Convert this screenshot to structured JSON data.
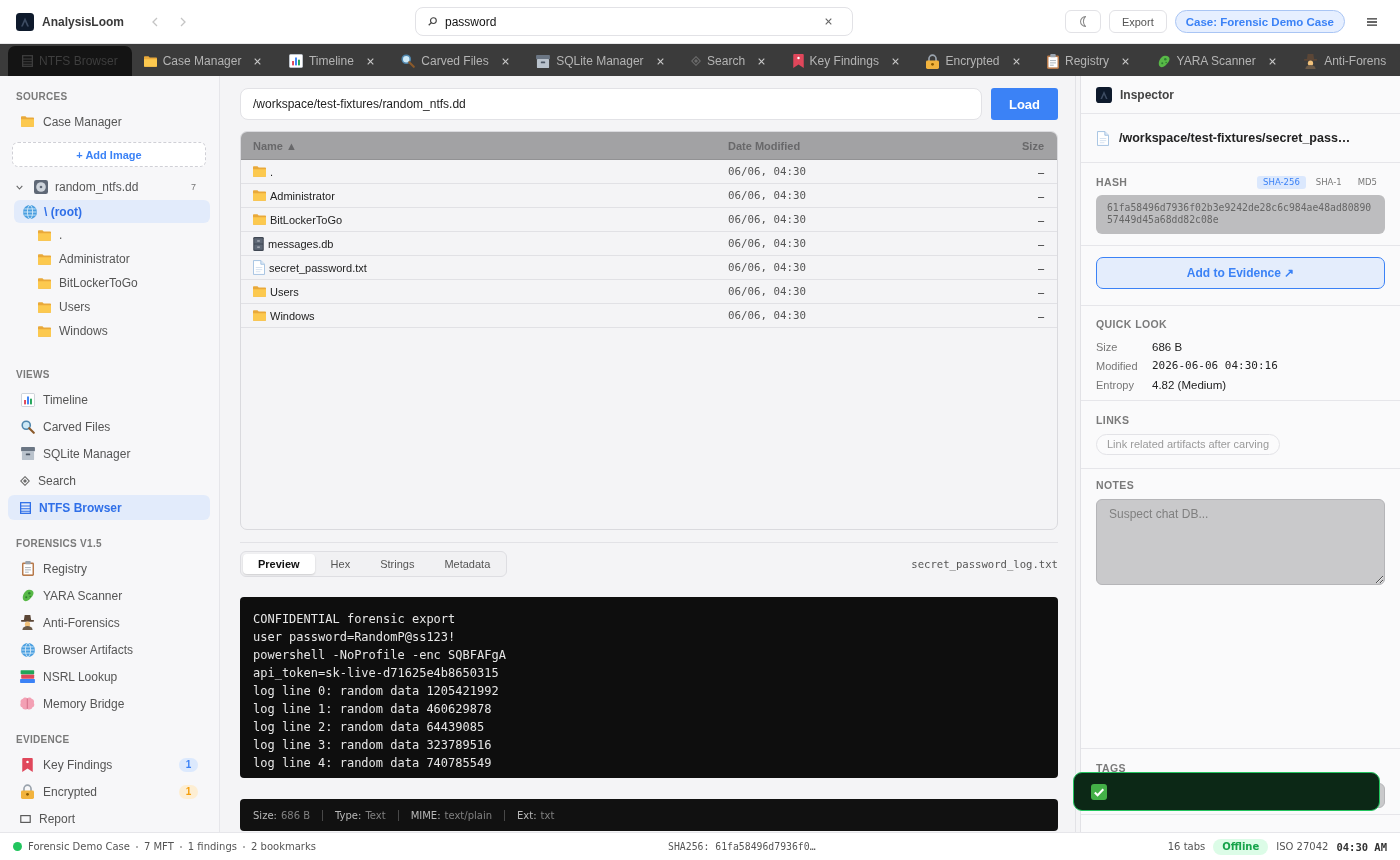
{
  "header": {
    "app_name": "AnalysisLoom",
    "nav": [
      {
        "kind": "back",
        "disabled": true
      },
      {
        "kind": "forward",
        "disabled": true
      }
    ],
    "search": {
      "value": "password"
    },
    "export_button": "Export",
    "case_badge": "Case: Forensic Demo Case"
  },
  "tabs": [
    {
      "label": "NTFS Browser",
      "kind": "list",
      "selected": true,
      "closable": false
    },
    {
      "label": "Case Manager",
      "kind": "folder",
      "selected": false,
      "closable": true
    },
    {
      "label": "Timeline",
      "kind": "chart",
      "selected": false,
      "closable": true
    },
    {
      "label": "Carved Files",
      "kind": "magnifier",
      "selected": false,
      "closable": true
    },
    {
      "label": "SQLite Manager",
      "kind": "cardbox",
      "selected": false,
      "closable": true
    },
    {
      "label": "Search",
      "kind": "diamond",
      "selected": false,
      "closable": true
    },
    {
      "label": "Key Findings",
      "kind": "bookmark",
      "selected": false,
      "closable": true
    },
    {
      "label": "Encrypted",
      "kind": "lock",
      "selected": false,
      "closable": true
    },
    {
      "label": "Registry",
      "kind": "clipboard",
      "selected": false,
      "closable": true
    },
    {
      "label": "YARA Scanner",
      "kind": "microbe",
      "selected": false,
      "closable": true
    },
    {
      "label": "Anti-Forens",
      "kind": "detective",
      "selected": false,
      "closable": false
    }
  ],
  "sidebar": {
    "sources": {
      "title": "SOURCES",
      "items": [
        {
          "label": "Case Manager",
          "kind": "folder",
          "selected": false
        }
      ],
      "add_button": "+ Add Image",
      "tree": [
        {
          "label": "random_ntfs.dd",
          "kind": "disk",
          "count": "7",
          "expanded": true,
          "selected": false,
          "children": [
            {
              "label": "\\ (root)",
              "kind": "globe",
              "selected": true,
              "children": [
                {
                  "label": ".",
                  "kind": "folder",
                  "selected": false
                },
                {
                  "label": "Administrator",
                  "kind": "folder",
                  "selected": false
                },
                {
                  "label": "BitLockerToGo",
                  "kind": "folder",
                  "selected": false
                },
                {
                  "label": "Users",
                  "kind": "folder",
                  "selected": false
                },
                {
                  "label": "Windows",
                  "kind": "folder",
                  "selected": false
                }
              ]
            }
          ]
        }
      ]
    },
    "sections": [
      {
        "title": "VIEWS",
        "items": [
          {
            "label": "Timeline",
            "kind": "chart",
            "selected": false
          },
          {
            "label": "Carved Files",
            "kind": "magnifier",
            "selected": false
          },
          {
            "label": "SQLite Manager",
            "kind": "cardbox",
            "selected": false
          },
          {
            "label": "Search",
            "kind": "diamond",
            "selected": false
          },
          {
            "label": "NTFS Browser",
            "kind": "list",
            "selected": true
          }
        ]
      },
      {
        "title": "FORENSICS V1.5",
        "items": [
          {
            "label": "Registry",
            "kind": "clipboard",
            "selected": false
          },
          {
            "label": "YARA Scanner",
            "kind": "microbe",
            "selected": false
          },
          {
            "label": "Anti-Forensics",
            "kind": "detective",
            "selected": false
          },
          {
            "label": "Browser Artifacts",
            "kind": "globe",
            "selected": false
          },
          {
            "label": "NSRL Lookup",
            "kind": "books",
            "selected": false
          },
          {
            "label": "Memory Bridge",
            "kind": "brain",
            "selected": false
          }
        ]
      },
      {
        "title": "EVIDENCE",
        "items": [
          {
            "label": "Key Findings",
            "kind": "bookmark",
            "selected": false,
            "badge": {
              "text": "1",
              "color": "#3b82f6"
            }
          },
          {
            "label": "Encrypted",
            "kind": "lock",
            "selected": false,
            "badge": {
              "text": "1",
              "color": "#f59e0b"
            }
          },
          {
            "label": "Report",
            "kind": "rect",
            "selected": false
          }
        ]
      }
    ]
  },
  "browser": {
    "path": {
      "value": "/workspace/test-fixtures/random_ntfs.dd",
      "button": "Load"
    },
    "table": {
      "columns": [
        "Name ▲",
        "Date Modified",
        "Size"
      ],
      "rows": [
        {
          "kind": "folder",
          "name": ".",
          "modified": "06/06, 04:30",
          "size": "–"
        },
        {
          "kind": "folder",
          "name": "Administrator",
          "modified": "06/06, 04:30",
          "size": "–"
        },
        {
          "kind": "folder",
          "name": "BitLockerToGo",
          "modified": "06/06, 04:30",
          "size": "–"
        },
        {
          "kind": "cabinet",
          "name": "messages.db",
          "modified": "06/06, 04:30",
          "size": "–"
        },
        {
          "kind": "document",
          "name": "secret_password.txt",
          "modified": "06/06, 04:30",
          "size": "–"
        },
        {
          "kind": "folder",
          "name": "Users",
          "modified": "06/06, 04:30",
          "size": "–"
        },
        {
          "kind": "folder",
          "name": "Windows",
          "modified": "06/06, 04:30",
          "size": "–"
        }
      ]
    }
  },
  "preview": {
    "tabs": [
      {
        "label": "Preview",
        "selected": true
      },
      {
        "label": "Hex",
        "selected": false
      },
      {
        "label": "Strings",
        "selected": false
      },
      {
        "label": "Metadata",
        "selected": false
      }
    ],
    "file_name": "secret_password_log.txt",
    "lines": [
      "CONFIDENTIAL forensic export",
      "user password=RandomP@ss123!",
      "powershell -NoProfile -enc SQBFAFgA",
      "api_token=sk-live-d71625e4b8650315",
      "log line 0: random data 1205421992",
      "log line 1: random data 460629878",
      "log line 2: random data 64439085",
      "log line 3: random data 323789516",
      "log line 4: random data 740785549"
    ],
    "info": [
      {
        "label": "Size:",
        "value": "686 B"
      },
      {
        "label": "Type:",
        "value": "Text"
      },
      {
        "label": "MIME:",
        "value": "text/plain"
      },
      {
        "label": "Ext:",
        "value": "txt"
      }
    ]
  },
  "inspector": {
    "title": "Inspector",
    "file_path": "/workspace/test-fixtures/secret_pass…",
    "hash": {
      "title": "HASH",
      "algorithms": [
        {
          "label": "SHA-256",
          "selected": true
        },
        {
          "label": "SHA-1",
          "selected": false
        },
        {
          "label": "MD5",
          "selected": false
        }
      ],
      "value": "61fa58496d7936f02b3e9242de28c6c984ae48ad8089057449d45a68dd82c08e"
    },
    "evidence_button": "Add to Evidence ↗",
    "quick_look": {
      "title": "QUICK LOOK",
      "fields": [
        {
          "label": "Size",
          "value": "686 B",
          "kind": "text"
        },
        {
          "label": "Modified",
          "value": "2026-06-06 04:30:16",
          "kind": "mono"
        },
        {
          "label": "Entropy",
          "value": "4.82 (Medium)",
          "kind": "text"
        }
      ]
    },
    "links": {
      "title": "LINKS",
      "hint": "Link related artifacts after carving"
    },
    "notes": {
      "title": "NOTES",
      "placeholder": "Suspect chat DB..."
    },
    "tags": {
      "title": "TAGS"
    }
  },
  "toast": {
    "visible": true
  },
  "status_bar": {
    "case": "Forensic Demo Case",
    "stats": [
      "7 MFT",
      "1 findings",
      "2 bookmarks"
    ],
    "hash": "SHA256: 61fa58496d7936f0…",
    "tabs_count": "16 tabs",
    "network": "Offline",
    "standard": "ISO 27042",
    "time": "04:30 AM"
  }
}
